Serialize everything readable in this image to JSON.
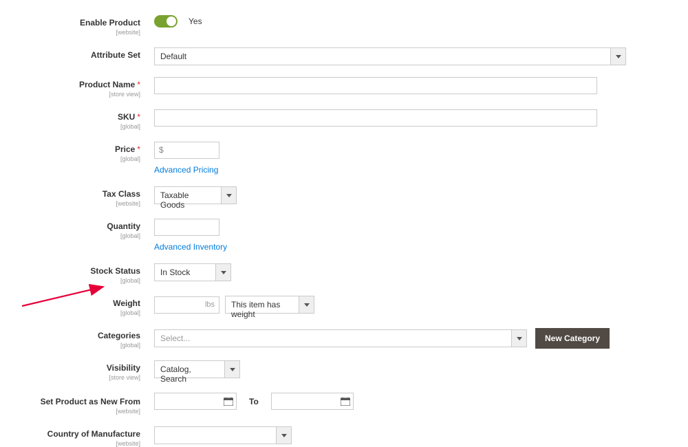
{
  "fields": {
    "enable": {
      "label": "Enable Product",
      "scope": "[website]",
      "value": "Yes"
    },
    "attribute_set": {
      "label": "Attribute Set",
      "value": "Default"
    },
    "product_name": {
      "label": "Product Name",
      "scope": "[store view]",
      "value": ""
    },
    "sku": {
      "label": "SKU",
      "scope": "[global]",
      "value": ""
    },
    "price": {
      "label": "Price",
      "scope": "[global]",
      "currency": "$",
      "value": "",
      "link": "Advanced Pricing"
    },
    "tax_class": {
      "label": "Tax Class",
      "scope": "[website]",
      "value": "Taxable Goods"
    },
    "quantity": {
      "label": "Quantity",
      "scope": "[global]",
      "value": "",
      "link": "Advanced Inventory"
    },
    "stock_status": {
      "label": "Stock Status",
      "scope": "[global]",
      "value": "In Stock"
    },
    "weight": {
      "label": "Weight",
      "scope": "[global]",
      "unit": "lbs",
      "value": "",
      "select": "This item has weight"
    },
    "categories": {
      "label": "Categories",
      "scope": "[global]",
      "placeholder": "Select...",
      "button": "New Category"
    },
    "visibility": {
      "label": "Visibility",
      "scope": "[store view]",
      "value": "Catalog, Search"
    },
    "new_from": {
      "label": "Set Product as New From",
      "scope": "[website]",
      "to_label": "To"
    },
    "country": {
      "label": "Country of Manufacture",
      "scope": "[website]",
      "value": ""
    }
  }
}
